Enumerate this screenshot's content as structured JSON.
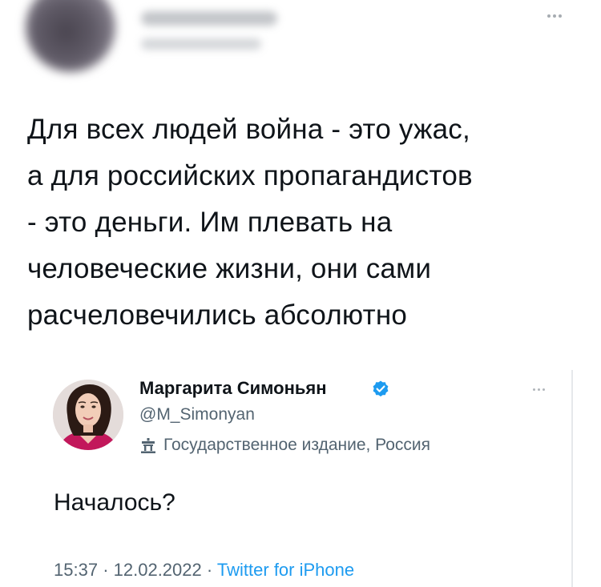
{
  "outer_tweet": {
    "text_lines": [
      "Для всех людей война - это ужас,",
      "а для российских пропагандистов",
      "- это деньги. Им плевать на",
      "человеческие жизни, они сами",
      "расчеловечились абсолютно"
    ]
  },
  "quoted_tweet": {
    "author_name": "Маргарита Симоньян",
    "handle": "@M_Simonyan",
    "label": "Государственное издание, Россия",
    "text": "Началось?",
    "time": "15:37",
    "date": "12.02.2022",
    "separator": "·",
    "source": "Twitter for iPhone"
  },
  "icons": {
    "more": "more-horizontal-icon",
    "verified": "verified-badge-icon",
    "state_media": "state-media-icon"
  },
  "colors": {
    "text": "#0f1419",
    "secondary": "#536471",
    "accent": "#1d9bf0"
  }
}
